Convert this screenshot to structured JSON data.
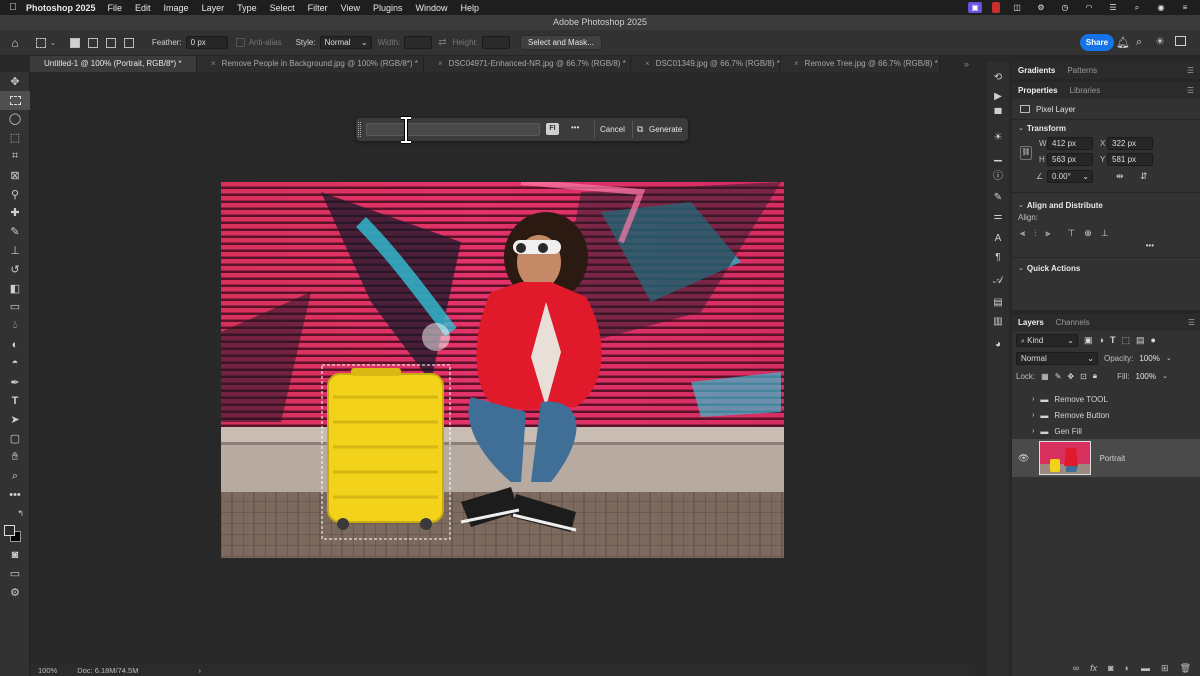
{
  "menubar": {
    "app_name": "Photoshop 2025",
    "items": [
      "File",
      "Edit",
      "Image",
      "Layer",
      "Type",
      "Select",
      "Filter",
      "View",
      "Plugins",
      "Window",
      "Help"
    ]
  },
  "window": {
    "title": "Adobe Photoshop 2025"
  },
  "options_bar": {
    "feather_label": "Feather:",
    "feather_value": "0 px",
    "anti_alias_label": "Anti-alias",
    "style_label": "Style:",
    "style_value": "Normal",
    "width_label": "Width:",
    "height_label": "Height:",
    "select_mask_label": "Select and Mask...",
    "share_label": "Share"
  },
  "tabs": [
    {
      "label": "Untitled-1 @ 100% (Portrait, RGB/8*) *",
      "active": true
    },
    {
      "label": "Remove People in Background.jpg @ 100% (RGB/8*) *",
      "active": false
    },
    {
      "label": "DSC04971-Enhanced-NR.jpg @ 66.7% (RGB/8) *",
      "active": false
    },
    {
      "label": "DSC01349.jpg @ 66.7% (RGB/8) *",
      "active": false
    },
    {
      "label": "Remove Tree.jpg @ 66.7% (RGB/8) *",
      "active": false
    }
  ],
  "contextual_taskbar": {
    "prompt_placeholder": "",
    "badge": "FI",
    "more": "•••",
    "cancel_label": "Cancel",
    "generate_label": "Generate"
  },
  "status": {
    "zoom": "100%",
    "doc": "Doc: 6.18M/74.5M",
    "arrow": "›"
  },
  "panels": {
    "top_tabs": [
      "Gradients",
      "Patterns"
    ],
    "properties_tabs": [
      "Properties",
      "Libraries"
    ],
    "pixel_layer_label": "Pixel Layer",
    "transform": {
      "title": "Transform",
      "w_label": "W",
      "w_value": "412 px",
      "x_label": "X",
      "x_value": "322 px",
      "h_label": "H",
      "h_value": "563 px",
      "y_label": "Y",
      "y_value": "581 px",
      "angle_value": "0.00°"
    },
    "align": {
      "title": "Align and Distribute",
      "align_label": "Align:",
      "more": "•••"
    },
    "quick_actions_title": "Quick Actions",
    "layers": {
      "tabs": [
        "Layers",
        "Channels"
      ],
      "kind_label": "Kind",
      "blend_mode": "Normal",
      "opacity_label": "Opacity:",
      "opacity_value": "100%",
      "lock_label": "Lock:",
      "fill_label": "Fill:",
      "fill_value": "100%",
      "items": [
        {
          "name": "Remove TOOL",
          "type": "group"
        },
        {
          "name": "Remove Button",
          "type": "group"
        },
        {
          "name": "Gen Fill",
          "type": "group"
        },
        {
          "name": "Portrait",
          "type": "pixel",
          "selected": true
        }
      ]
    }
  },
  "colors": {
    "accent": "#1473e6",
    "ui_dark": "#323232",
    "canvas_bg": "#282828"
  }
}
